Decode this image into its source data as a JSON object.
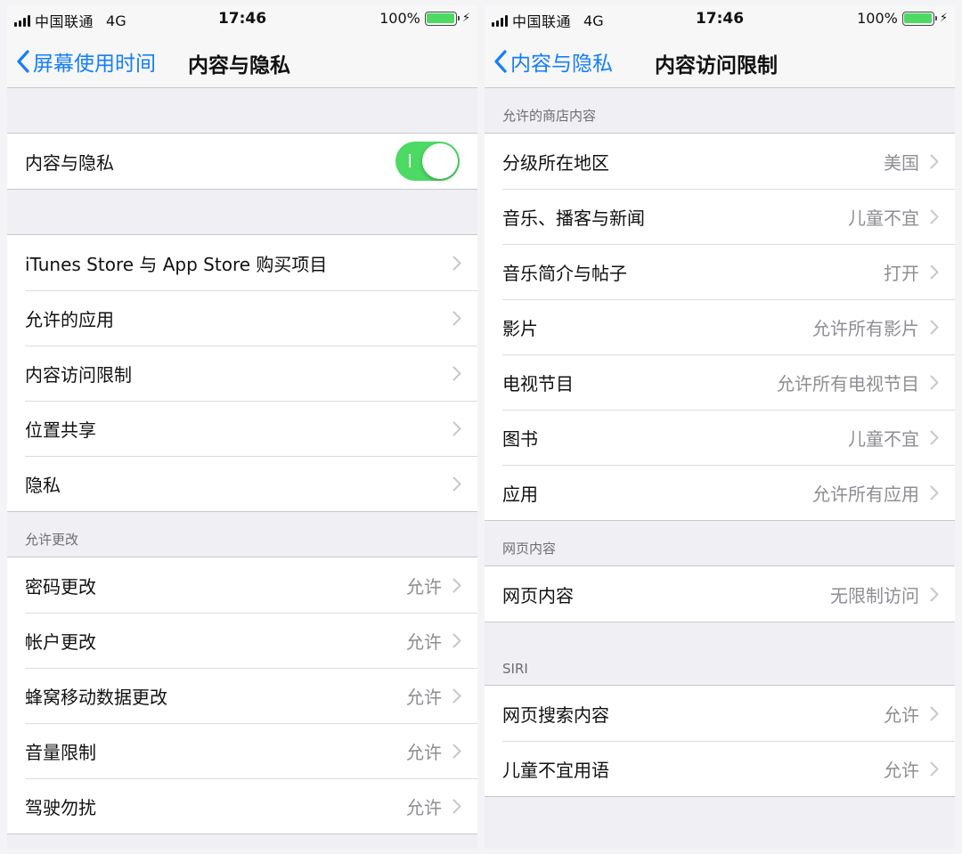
{
  "left": {
    "status": {
      "carrier": "中国联通",
      "network": "4G",
      "time": "17:46",
      "battery": "100%"
    },
    "nav": {
      "back_label": "屏幕使用时间",
      "title": "内容与隐私"
    },
    "toggle_row": {
      "label": "内容与隐私",
      "enabled": true
    },
    "items": [
      {
        "label": "iTunes Store 与 App Store 购买项目"
      },
      {
        "label": "允许的应用"
      },
      {
        "label": "内容访问限制"
      },
      {
        "label": "位置共享"
      },
      {
        "label": "隐私"
      }
    ],
    "allow_changes": {
      "header": "允许更改",
      "items": [
        {
          "label": "密码更改",
          "value": "允许"
        },
        {
          "label": "帐户更改",
          "value": "允许"
        },
        {
          "label": "蜂窝移动数据更改",
          "value": "允许"
        },
        {
          "label": "音量限制",
          "value": "允许"
        },
        {
          "label": "驾驶勿扰",
          "value": "允许"
        }
      ]
    }
  },
  "right": {
    "status": {
      "carrier": "中国联通",
      "network": "4G",
      "time": "17:46",
      "battery": "100%"
    },
    "nav": {
      "back_label": "内容与隐私",
      "title": "内容访问限制"
    },
    "store": {
      "header": "允许的商店内容",
      "items": [
        {
          "label": "分级所在地区",
          "value": "美国"
        },
        {
          "label": "音乐、播客与新闻",
          "value": "儿童不宜"
        },
        {
          "label": "音乐简介与帖子",
          "value": "打开"
        },
        {
          "label": "影片",
          "value": "允许所有影片"
        },
        {
          "label": "电视节目",
          "value": "允许所有电视节目"
        },
        {
          "label": "图书",
          "value": "儿童不宜"
        },
        {
          "label": "应用",
          "value": "允许所有应用"
        }
      ]
    },
    "web": {
      "header": "网页内容",
      "items": [
        {
          "label": "网页内容",
          "value": "无限制访问"
        }
      ]
    },
    "siri": {
      "header": "SIRI",
      "items": [
        {
          "label": "网页搜索内容",
          "value": "允许"
        },
        {
          "label": "儿童不宜用语",
          "value": "允许"
        }
      ]
    }
  },
  "colors": {
    "accent": "#147efb",
    "toggle_on": "#4cd964",
    "secondary_text": "#8e8e93",
    "grouped_bg": "#efeff4"
  }
}
